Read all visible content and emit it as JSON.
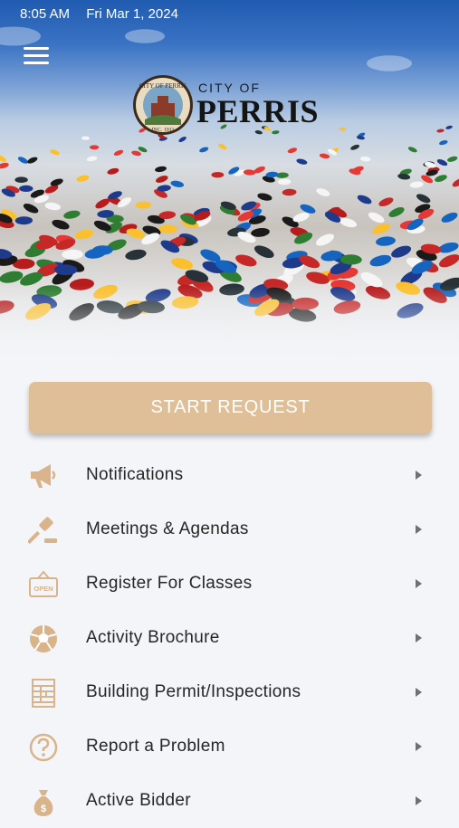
{
  "status_bar": {
    "time": "8:05 AM",
    "date": "Fri Mar 1, 2024"
  },
  "header": {
    "menu_icon": "hamburger-icon",
    "logo": {
      "city_of": "CITY OF",
      "name": "PERRIS",
      "seal_top": "CITY OF PERRIS",
      "seal_bottom": "INC. 1911"
    }
  },
  "start_request": {
    "label": "START REQUEST",
    "color": "#dfbf98"
  },
  "menu": {
    "accent_color": "#d9b48a",
    "items": [
      {
        "label": "Notifications",
        "icon": "megaphone-icon"
      },
      {
        "label": "Meetings & Agendas",
        "icon": "gavel-icon"
      },
      {
        "label": "Register For Classes",
        "icon": "open-sign-icon",
        "icon_text": "OPEN"
      },
      {
        "label": "Activity Brochure",
        "icon": "soccer-ball-icon"
      },
      {
        "label": "Building Permit/Inspections",
        "icon": "building-plan-icon"
      },
      {
        "label": "Report a Problem",
        "icon": "question-circle-icon"
      },
      {
        "label": "Active Bidder",
        "icon": "money-bag-icon"
      }
    ]
  }
}
